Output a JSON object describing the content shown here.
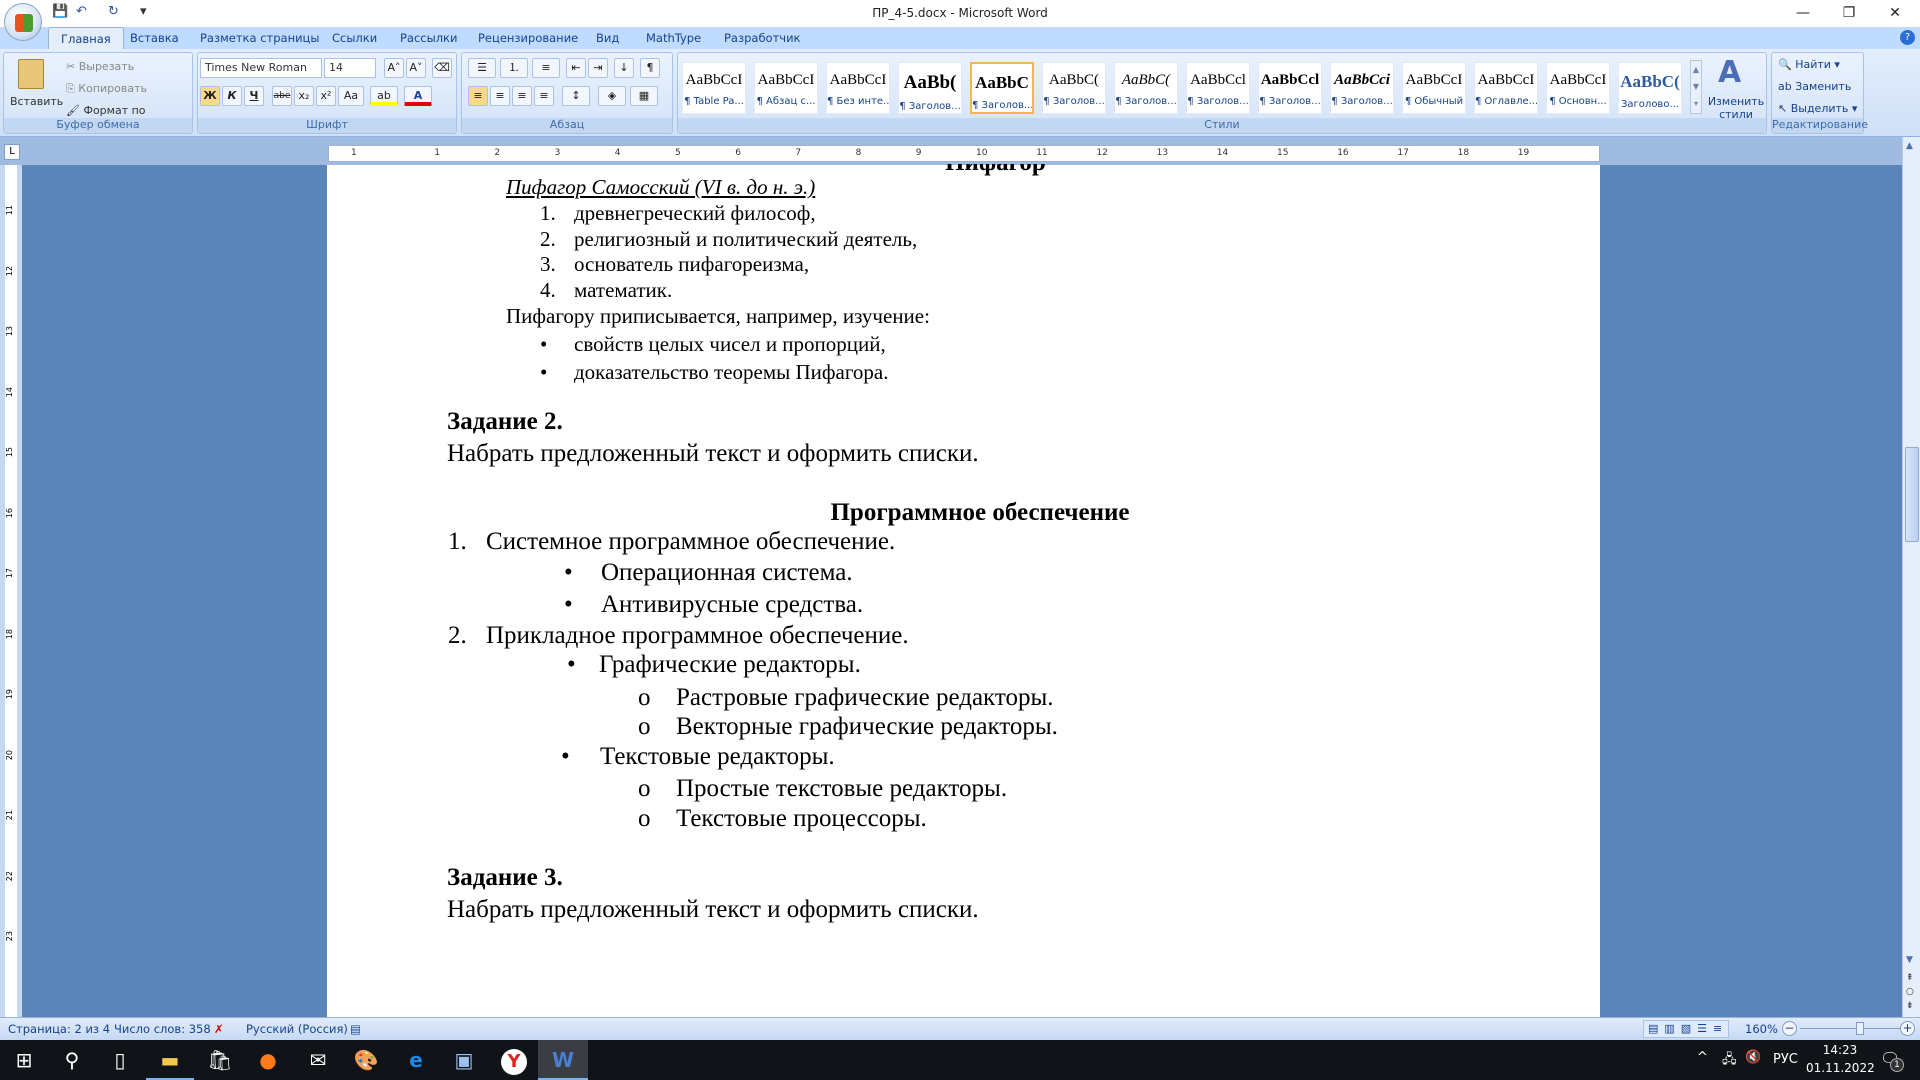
{
  "window": {
    "title": "ПР_4-5.docx - Microsoft Word",
    "minimize": "—",
    "restore": "❐",
    "close": "✕"
  },
  "quick_access": {
    "save": "💾",
    "undo": "↶",
    "redo": "↻",
    "customize": "▾"
  },
  "tabs": [
    "Главная",
    "Вставка",
    "Разметка страницы",
    "Ссылки",
    "Рассылки",
    "Рецензирование",
    "Вид",
    "MathType",
    "Разработчик"
  ],
  "clipboard": {
    "paste": "Вставить",
    "cut": "Вырезать",
    "copy": "Копировать",
    "format_painter": "Формат по образцу",
    "label": "Буфер обмена"
  },
  "font": {
    "name": "Times New Roman",
    "size": "14",
    "bold": "Ж",
    "italic": "К",
    "underline": "Ч",
    "strike": "abe",
    "sub": "x₂",
    "sup": "x²",
    "case": "Aa",
    "grow": "A˄",
    "shrink": "A˅",
    "label": "Шрифт",
    "highlight_color": "#ffff00",
    "font_color": "#e00000"
  },
  "paragraph": {
    "label": "Абзац",
    "pilcrow": "¶"
  },
  "styles": {
    "label": "Стили",
    "items": [
      {
        "sample": "AaBbCcI",
        "name": "¶ Table Pa..."
      },
      {
        "sample": "AaBbCcI",
        "name": "¶ Абзац с..."
      },
      {
        "sample": "AaBbCcI",
        "name": "¶ Без инте..."
      },
      {
        "sample": "AaBb(",
        "name": "¶ Заголов..."
      },
      {
        "sample": "AaBbC",
        "name": "¶ Заголов..."
      },
      {
        "sample": "AaBbC(",
        "name": "¶ Заголов..."
      },
      {
        "sample": "AaBbC(",
        "name": "¶ Заголов..."
      },
      {
        "sample": "AaBbCcl",
        "name": "¶ Заголов..."
      },
      {
        "sample": "AaBbCcl",
        "name": "¶ Заголов..."
      },
      {
        "sample": "AaBbCci",
        "name": "¶ Заголов..."
      },
      {
        "sample": "AaBbCcI",
        "name": "¶ Обычный"
      },
      {
        "sample": "AaBbCcI",
        "name": "¶ Оглавле..."
      },
      {
        "sample": "AaBbCcI",
        "name": "¶ Основн..."
      },
      {
        "sample": "AaBbC(",
        "name": "Заголово..."
      }
    ],
    "change_styles": "Изменить стили"
  },
  "editing": {
    "label": "Редактирование",
    "find": "Найти",
    "replace": "Заменить",
    "select": "Выделить"
  },
  "ruler": {
    "numbers": [
      "1",
      "1",
      "2",
      "3",
      "4",
      "5",
      "6",
      "7",
      "8",
      "9",
      "10",
      "11",
      "12",
      "13",
      "14",
      "15",
      "16",
      "17",
      "18",
      "19"
    ]
  },
  "vruler": {
    "numbers": [
      "11",
      "12",
      "13",
      "14",
      "15",
      "16",
      "17",
      "18",
      "19",
      "20",
      "21",
      "22",
      "23"
    ]
  },
  "document": {
    "clipped_heading": "Пифагор",
    "subtitle": "Пифагор Самосский (VI в. до н. э.)",
    "list1": [
      "древнегреческий философ,",
      "религиозный и политический деятель,",
      "основатель пифагореизма,",
      "математик."
    ],
    "para1": "Пифагору приписывается, например, изучение:",
    "list2": [
      "свойств целых чисел и пропорций,",
      "доказательство теоремы Пифагора."
    ],
    "task2_title": "Задание 2.",
    "task2_text": "Набрать предложенный текст и оформить списки.",
    "center_title": "Программное обеспечение",
    "item1": "Системное программное обеспечение.",
    "item1_sub": [
      "Операционная система.",
      "Антивирусные средства."
    ],
    "item2": "Прикладное программное обеспечение.",
    "item2_sub1": "Графические редакторы.",
    "item2_sub1_sub": [
      "Растровые графические редакторы.",
      "Векторные графические редакторы."
    ],
    "item2_sub2": "Текстовые редакторы.",
    "item2_sub2_sub": [
      "Простые текстовые редакторы.",
      "Текстовые процессоры."
    ],
    "task3_title": "Задание 3.",
    "task3_text": "Набрать предложенный текст и оформить списки.",
    "num1": "1.",
    "num2": "2.",
    "num3": "3.",
    "num4": "4.",
    "bullet": "•",
    "circle": "o"
  },
  "status": {
    "page": "Страница: 2 из 4",
    "words": "Число слов: 358",
    "language": "Русский (Россия)",
    "zoom": "160%",
    "zoom_percent": 160
  },
  "taskbar": {
    "lang": "РУС",
    "time": "14:23",
    "date": "01.11.2022",
    "notifications": "1"
  }
}
